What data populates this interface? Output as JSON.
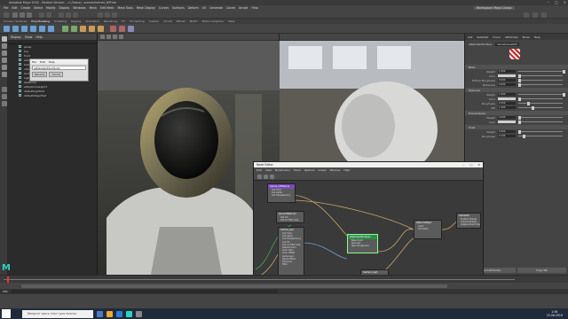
{
  "title_bar": {
    "title": "Autodesk Maya 2018 - Student Version: ...C:/Users/...scenes/helmet_WIP.mb",
    "controls": [
      "–",
      "□",
      "×"
    ]
  },
  "menu": {
    "items": [
      "File",
      "Edit",
      "Create",
      "Select",
      "Modify",
      "Display",
      "Windows",
      "Mesh",
      "Edit Mesh",
      "Mesh Tools",
      "Mesh Display",
      "Curves",
      "Surfaces",
      "Deform",
      "UV",
      "Generate",
      "Cache",
      "Arnold",
      "Help"
    ],
    "workspace": "Workspace: Maya Classic"
  },
  "shelf_tabs": {
    "items": [
      "Curves / Surfaces",
      "Poly Modeling",
      "Sculpting",
      "Rigging",
      "Animation",
      "Rendering",
      "FX",
      "FX Caching",
      "Custom",
      "Arnold",
      "Bifrost",
      "MASH",
      "Motion Graphics",
      "XGen"
    ],
    "active_index": 1
  },
  "outliner": {
    "menu": [
      "Display",
      "Show",
      "Help"
    ],
    "items": [
      "persp",
      "top",
      "front",
      "side",
      "helmet_grp",
      "visor",
      "body",
      "Light",
      "skyDome",
      "aiSkyDomeLight1",
      "defaultLightSet",
      "defaultObjectSet"
    ]
  },
  "popup": {
    "menu": [
      "File",
      "Edit",
      "Help"
    ],
    "field": "aiStandardSurface1",
    "buttons": [
      "Rename",
      "Cancel"
    ]
  },
  "attribute_editor": {
    "tabs": [
      "List",
      "Selected",
      "Focus",
      "Attributes",
      "Show",
      "Help"
    ],
    "node_label": "aiStandardSurface:",
    "node_name": "helmetGlossMAT",
    "sections": [
      {
        "title": "Base",
        "rows": [
          {
            "label": "Weight",
            "value": "1.000",
            "level": 1.0
          },
          {
            "label": "Color",
            "value": "",
            "level": 0.0
          },
          {
            "label": "Diffuse Roughness",
            "value": "0.000",
            "level": 0.0
          },
          {
            "label": "Metalness",
            "value": "0.000",
            "level": 0.0
          }
        ]
      },
      {
        "title": "Specular",
        "rows": [
          {
            "label": "Weight",
            "value": "1.000",
            "level": 1.0
          },
          {
            "label": "Color",
            "value": "",
            "level": 0.0
          },
          {
            "label": "Roughness",
            "value": "0.200",
            "level": 0.2
          },
          {
            "label": "IOR",
            "value": "1.500",
            "level": 0.3
          }
        ]
      },
      {
        "title": "Transmission",
        "rows": [
          {
            "label": "Weight",
            "value": "0.000",
            "level": 0.0
          },
          {
            "label": "Color",
            "value": "",
            "level": 0.0
          }
        ]
      },
      {
        "title": "Coat",
        "rows": [
          {
            "label": "Weight",
            "value": "0.000",
            "level": 0.0
          },
          {
            "label": "Roughness",
            "value": "0.100",
            "level": 0.1
          }
        ]
      }
    ],
    "bottom_buttons": [
      "Load Attributes",
      "Copy Tab"
    ]
  },
  "node_editor": {
    "title": "Node Editor",
    "window_controls": [
      "–",
      "□",
      "×"
    ],
    "menu": [
      "Edit",
      "View",
      "Bookmarks",
      "Show",
      "Options",
      "Graph",
      "Window",
      "Help"
    ],
    "nodes": [
      {
        "name": "helmet_diffTexture",
        "ports": [
          "Outputs",
          "Out Color",
          "Out Alpha",
          "Out Transparency"
        ]
      },
      {
        "name": "place2dTexture1",
        "ports": [
          "Outputs",
          "Out UV",
          "Out Uv Filter Size"
        ]
      },
      {
        "name": "aiStandardSurface1",
        "ports": [
          "Base Color",
          "Specular",
          "Spec Roughness",
          "Normal Camera"
        ]
      },
      {
        "name": "aiNormalMap1",
        "ports": [
          "Input",
          "Out Value"
        ]
      },
      {
        "name": "helmet_spec",
        "ports": [
          "Outputs",
          "Out Color",
          "Out Alpha",
          "Out Transparency",
          "Out UV",
          "Out Uv Filter Size",
          "Default Color",
          "Color Gain",
          "Color Offset",
          "Alpha Gain",
          "Alpha Offset",
          "Exposure",
          "Filter"
        ]
      },
      {
        "name": "helmet_rough",
        "ports": [
          "Outputs",
          "Out Color",
          "Out Alpha"
        ]
      },
      {
        "name": "helmetSG",
        "ports": [
          "Surface Shader",
          "Volume Shader",
          "Displacement Shader"
        ]
      }
    ]
  },
  "command_line": {
    "label": "MEL"
  },
  "taskbar": {
    "search_placeholder": "Введите здесь текст для поиска",
    "time": "1:56",
    "date": "25.06.2019"
  },
  "colors": {
    "maya_teal": "#2dd2c6",
    "node_purple": "#7a4ab8",
    "node_green": "#2e8f4a",
    "node_edge": "#c9a86a"
  }
}
